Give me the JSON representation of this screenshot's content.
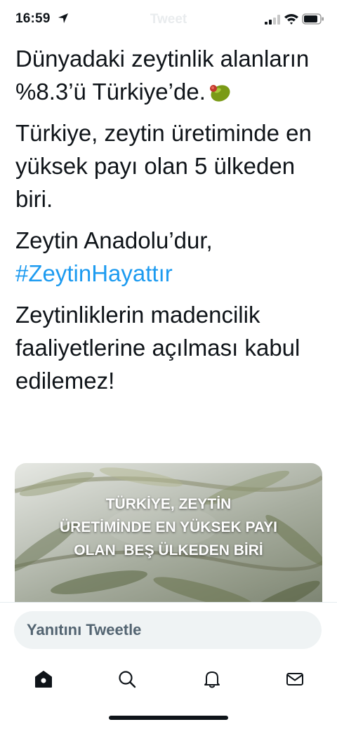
{
  "status_bar": {
    "time": "16:59",
    "ghost_title": "Tweet",
    "icons": [
      "location-arrow-icon",
      "cellular-signal-icon",
      "wifi-icon",
      "battery-icon"
    ]
  },
  "tweet": {
    "paragraphs": [
      "Dünyadaki zeytinlik alanların %8.3’ü Türkiye’de.",
      "Türkiye, zeytin üretiminde en yüksek payı olan 5 ülkeden biri.",
      "Zeytin Anadolu’dur,",
      "Zeytinliklerin madencilik faaliyetlerine açılması kabul edilemez!"
    ],
    "emoji": "olive-icon",
    "hashtag": "#ZeytinHayattır"
  },
  "media": {
    "caption_lines": [
      "TÜRKİYE, ZEYTİN",
      "ÜRETİMİNDE EN YÜKSEK PAYI",
      "OLAN  BEŞ ÜLKEDEN BİRİ"
    ]
  },
  "reply": {
    "placeholder": "Yanıtını Tweetle"
  },
  "tabs": [
    "home-icon",
    "search-icon",
    "notifications-bell-icon",
    "messages-envelope-icon"
  ],
  "colors": {
    "link": "#1d9bf0",
    "text": "#0f1419",
    "reply_bg": "#eff3f4",
    "placeholder": "#536471"
  }
}
